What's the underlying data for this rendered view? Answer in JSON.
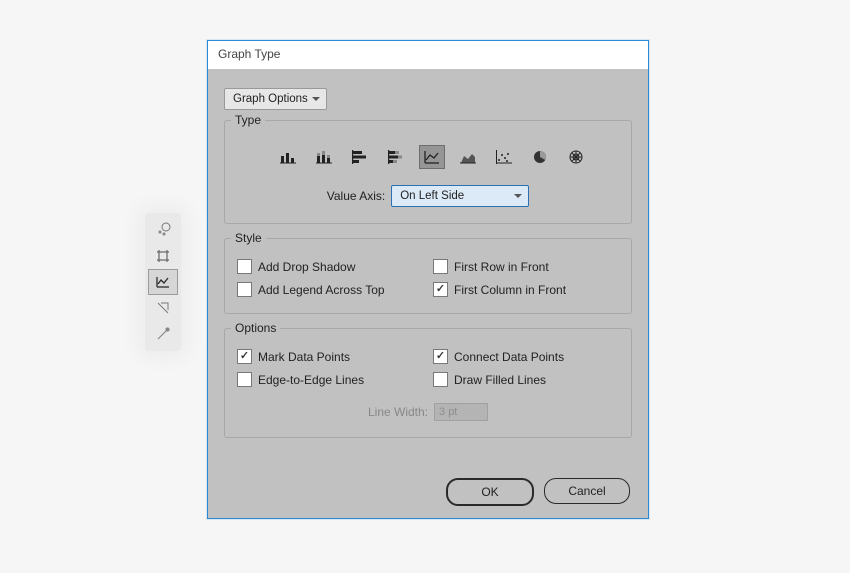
{
  "toolbar": {
    "tools": [
      {
        "name": "spray-tool-icon"
      },
      {
        "name": "artboard-tool-icon"
      },
      {
        "name": "graph-tool-icon"
      },
      {
        "name": "slice-tool-icon"
      },
      {
        "name": "eyedropper-tool-icon"
      }
    ],
    "selected_index": 2
  },
  "dialog": {
    "title": "Graph Type",
    "options_select": "Graph Options",
    "group_type": {
      "legend": "Type",
      "icons": [
        "column-graph-icon",
        "stacked-column-graph-icon",
        "bar-graph-icon",
        "stacked-bar-graph-icon",
        "line-graph-icon",
        "area-graph-icon",
        "scatter-graph-icon",
        "pie-graph-icon",
        "radar-graph-icon"
      ],
      "selected_index": 4,
      "value_axis_label": "Value Axis:",
      "value_axis_value": "On Left Side"
    },
    "group_style": {
      "legend": "Style",
      "items": [
        {
          "label": "Add Drop Shadow",
          "checked": false
        },
        {
          "label": "First Row in Front",
          "checked": false
        },
        {
          "label": "Add Legend Across Top",
          "checked": false
        },
        {
          "label": "First Column in Front",
          "checked": true
        }
      ]
    },
    "group_options": {
      "legend": "Options",
      "items": [
        {
          "label": "Mark Data Points",
          "checked": true
        },
        {
          "label": "Connect Data Points",
          "checked": true
        },
        {
          "label": "Edge-to-Edge Lines",
          "checked": false
        },
        {
          "label": "Draw Filled Lines",
          "checked": false
        }
      ],
      "line_width_label": "Line Width:",
      "line_width_value": "3 pt"
    },
    "buttons": {
      "ok": "OK",
      "cancel": "Cancel"
    }
  }
}
